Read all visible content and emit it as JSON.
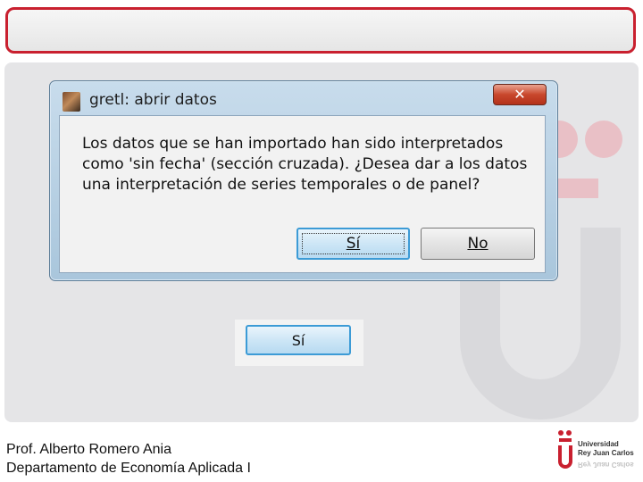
{
  "dialog": {
    "title": "gretl: abrir datos",
    "close_symbol": "✕",
    "message": "Los datos que se han importado han sido interpretados como 'sin fecha' (sección cruzada).  ¿Desea dar a los datos una interpretación de series temporales o de panel?",
    "yes_label": "Sí",
    "no_label": "No"
  },
  "standalone_button": {
    "label": "Sí"
  },
  "footer": {
    "author": "Prof. Alberto Romero Ania",
    "department": "Departamento de Economía Aplicada I",
    "university_line1": "Universidad",
    "university_line2": "Rey Juan Carlos"
  },
  "colors": {
    "brand_red": "#c9202f",
    "button_focus_blue": "#3c9bd6"
  },
  "icons": {
    "dialog_app_icon": "gretl-app-icon",
    "close_icon": "close-icon",
    "university_logo": "urjc-logo"
  }
}
